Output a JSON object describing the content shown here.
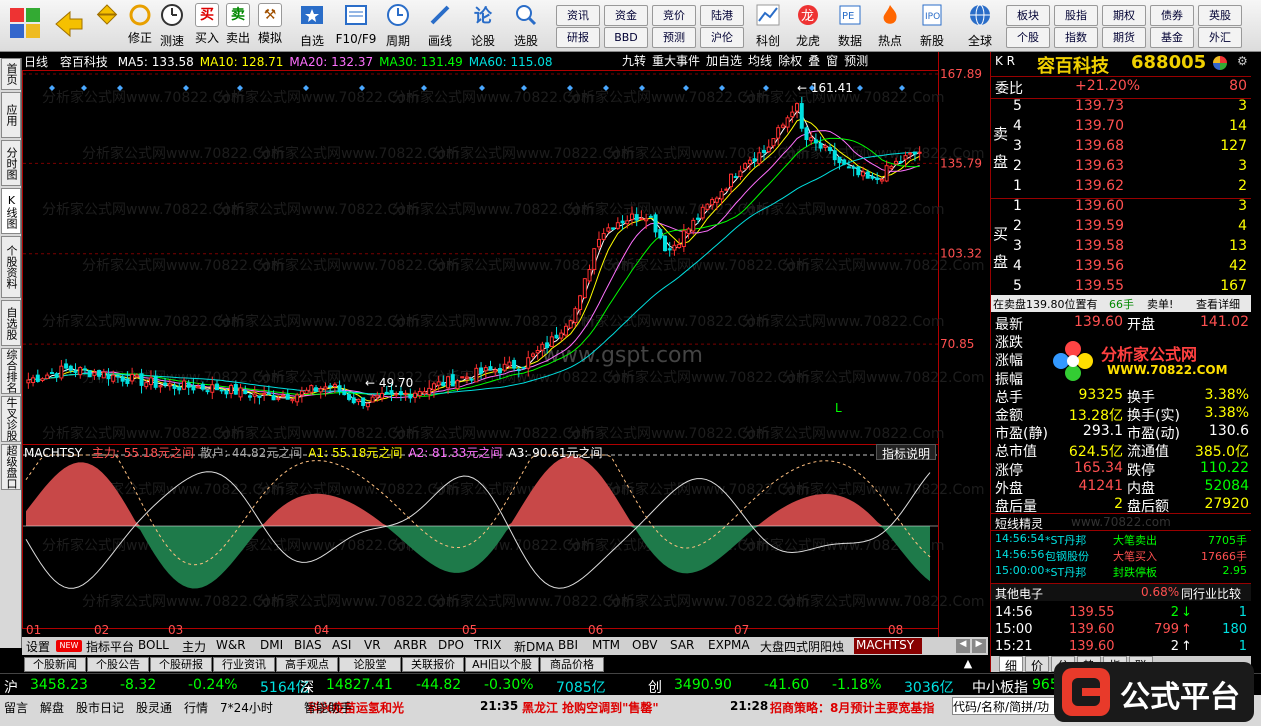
{
  "toolbar": {
    "left_buttons": [
      {
        "icon": "买",
        "label": "买入"
      },
      {
        "icon": "卖",
        "label": "卖出"
      },
      {
        "icon": "⚒",
        "label": "模拟"
      }
    ],
    "back_fwd": [
      {
        "label": "修正"
      },
      {
        "label": "测速"
      }
    ],
    "main_buttons": [
      {
        "label": "自选"
      },
      {
        "label": "F10/F9"
      },
      {
        "label": "周期"
      },
      {
        "label": "画线"
      },
      {
        "label": "论股"
      },
      {
        "label": "选股"
      }
    ],
    "small_grid1": [
      "资讯",
      "资金",
      "竞价",
      "陆港",
      "研报",
      "BBD",
      "预测",
      "沪伦"
    ],
    "icon_buttons": [
      {
        "label": "科创"
      },
      {
        "label": "龙虎"
      },
      {
        "label": "数据"
      },
      {
        "label": "热点"
      },
      {
        "label": "新股"
      }
    ],
    "global_label": "全球",
    "small_grid2": [
      "板块",
      "股指",
      "期权",
      "债券",
      "英股",
      "个股",
      "指数",
      "期货",
      "基金",
      "外汇"
    ]
  },
  "side_tabs": [
    "首页",
    "应用",
    "分时图",
    "K线图",
    "个股资料",
    "自选股",
    "综合排名",
    "牛叉诊股",
    "超级盘口"
  ],
  "chart": {
    "period_label": "日线",
    "stock_name": "容百科技",
    "ma_line": [
      {
        "text": "MA5: 133.58",
        "color": "#ffffff"
      },
      {
        "text": "MA10: 128.71",
        "color": "#ffff00"
      },
      {
        "text": "MA20: 132.37",
        "color": "#ff70ff"
      },
      {
        "text": "MA30: 131.49",
        "color": "#00ff00"
      },
      {
        "text": "MA60: 115.08",
        "color": "#00e0e0"
      }
    ],
    "top_tools": [
      "九转",
      "重大事件",
      "加自选",
      "均线",
      "除权",
      "叠",
      "窗",
      "预测"
    ],
    "price_axis": [
      "167.89",
      "135.79",
      "103.32",
      "70.85"
    ],
    "high_label": "161.41",
    "low_label": "49.70",
    "watermark_site": "www.gspt.com",
    "watermark_text": "分析家公式网www.70822.Com",
    "l_marker": "L"
  },
  "indicator": {
    "title": "MACHTSY",
    "fields": [
      {
        "text": "主力: 55.18元之间",
        "color": "#ff5050"
      },
      {
        "text": "散户: 44.82元之间",
        "color": "#aaaaaa"
      },
      {
        "text": "A1: 55.18元之间",
        "color": "#ffff00"
      },
      {
        "text": "A2: 81.33元之间",
        "color": "#ff70ff"
      },
      {
        "text": "A3: 90.61元之间",
        "color": "#ffffff"
      }
    ],
    "explain_btn": "指标说明"
  },
  "x_axis": [
    "01",
    "02",
    "03",
    "04",
    "05",
    "06",
    "07",
    "08"
  ],
  "bottom_tabs": [
    "设置",
    "指标平台",
    "BOLL",
    "主力",
    "W&R",
    "DMI",
    "BIAS",
    "ASI",
    "VR",
    "ARBR",
    "DPO",
    "TRIX",
    "新DMA",
    "BBI",
    "MTM",
    "OBV",
    "SAR",
    "EXPMA",
    "大盘四式阴阳烛",
    "MACHTSY"
  ],
  "new_badge": "NEW",
  "news_tabs": [
    "个股新闻",
    "个股公告",
    "个股研报",
    "行业资讯",
    "高手观点",
    "论股堂",
    "关联报价",
    "AH旧以个股",
    "商品价格"
  ],
  "quote": {
    "header_left": "K R",
    "stock_title": "容百科技",
    "stock_code": "688005",
    "weibi_label": "委比",
    "weibi_value": "+21.20%",
    "weibi_diff": "80",
    "sell_side": "卖盘",
    "buy_side": "买盘",
    "sells": [
      {
        "lvl": "5",
        "price": "139.73",
        "vol": "3"
      },
      {
        "lvl": "4",
        "price": "139.70",
        "vol": "14"
      },
      {
        "lvl": "3",
        "price": "139.68",
        "vol": "127"
      },
      {
        "lvl": "2",
        "price": "139.63",
        "vol": "3"
      },
      {
        "lvl": "1",
        "price": "139.62",
        "vol": "2"
      }
    ],
    "buys": [
      {
        "lvl": "1",
        "price": "139.60",
        "vol": "3"
      },
      {
        "lvl": "2",
        "price": "139.59",
        "vol": "4"
      },
      {
        "lvl": "3",
        "price": "139.58",
        "vol": "13"
      },
      {
        "lvl": "4",
        "price": "139.56",
        "vol": "42"
      },
      {
        "lvl": "5",
        "price": "139.55",
        "vol": "167"
      }
    ],
    "order_line": "在卖盘139.80位置有",
    "order_vol": "66手",
    "order_tag": "卖单!",
    "detail_link": "查看详细",
    "stats": [
      {
        "l1": "最新",
        "v1": "139.60",
        "l2": "开盘",
        "v2": "141.02",
        "c1": "#ff5050",
        "c2": "#ff5050"
      },
      {
        "l1": "涨跌",
        "v1": "",
        "l2": "",
        "v2": "",
        "c1": "#ff5050",
        "c2": "#ff5050"
      },
      {
        "l1": "涨幅",
        "v1": "",
        "l2": "",
        "v2": "",
        "c1": "#ff5050",
        "c2": "#ff5050"
      },
      {
        "l1": "振幅",
        "v1": "",
        "l2": "",
        "v2": "",
        "c1": "#ffffff",
        "c2": "#ffffff"
      },
      {
        "l1": "总手",
        "v1": "93325",
        "l2": "换手",
        "v2": "3.38%",
        "c1": "#ffff00",
        "c2": "#ffff00"
      },
      {
        "l1": "金额",
        "v1": "13.28亿",
        "l2": "换手(实)",
        "v2": "3.38%",
        "c1": "#ffff00",
        "c2": "#ffff00"
      },
      {
        "l1": "市盈(静)",
        "v1": "293.1",
        "l2": "市盈(动)",
        "v2": "130.6",
        "c1": "#ffffff",
        "c2": "#ffffff"
      },
      {
        "l1": "总市值",
        "v1": "624.5亿",
        "l2": "流通值",
        "v2": "385.0亿",
        "c1": "#ffff00",
        "c2": "#ffff00"
      },
      {
        "l1": "涨停",
        "v1": "165.34",
        "l2": "跌停",
        "v2": "110.22",
        "c1": "#ff5050",
        "c2": "#00ff00"
      },
      {
        "l1": "外盘",
        "v1": "41241",
        "l2": "内盘",
        "v2": "52084",
        "c1": "#ff5050",
        "c2": "#00ff00"
      },
      {
        "l1": "盘后量",
        "v1": "2",
        "l2": "盘后额",
        "v2": "27920",
        "c1": "#ffff00",
        "c2": "#ffff00"
      }
    ],
    "logo_text": "分析家公式网",
    "logo_site": "WWW.70822.COM",
    "short_title": "短线精灵",
    "short_site": "www.70822.com",
    "short_items": [
      {
        "time": "14:56:54",
        "name": "*ST丹邦",
        "event": "大笔卖出",
        "val": "7705手",
        "col": "#00ff00"
      },
      {
        "time": "14:56:56",
        "name": "包钢股份",
        "event": "大笔买入",
        "val": "17666手",
        "col": "#ff5050"
      },
      {
        "time": "15:00:00",
        "name": "*ST丹邦",
        "event": "封跌停板",
        "val": "2.95",
        "col": "#00ff00"
      }
    ],
    "sector_label": "其他电子",
    "sector_pct": "0.68%",
    "sector_btn": "同行业比较",
    "ticks": [
      {
        "time": "14:56",
        "price": "139.55",
        "vol": "2",
        "arrow": "↓",
        "count": "1",
        "vcol": "#00ff00"
      },
      {
        "time": "15:00",
        "price": "139.60",
        "vol": "799",
        "arrow": "↑",
        "count": "180",
        "vcol": "#ff5050"
      },
      {
        "time": "15:21",
        "price": "139.60",
        "vol": "2",
        "arrow": "↑",
        "count": "1",
        "vcol": "#ffffff"
      }
    ],
    "bottom_tabs": [
      "细",
      "价",
      "分",
      "势",
      "指",
      "联"
    ]
  },
  "index_bar": [
    {
      "name": "沪",
      "value": "3458.23",
      "chg": "-8.32",
      "pct": "-0.24%",
      "amt": "5164亿"
    },
    {
      "name": "深",
      "value": "14827.41",
      "chg": "-44.82",
      "pct": "-0.30%",
      "amt": "7085亿"
    },
    {
      "name": "创",
      "value": "3490.90",
      "chg": "-41.60",
      "pct": "-1.18%",
      "amt": "3036亿"
    }
  ],
  "index_extra": "中小板指",
  "index_extra_val": "965",
  "status": {
    "items": [
      "留言",
      "解盘",
      "股市日记",
      "股灵通",
      "行情",
      "7*24小时",
      "智能助手"
    ],
    "news1": "科兴疫苗运氢和光",
    "news2_time": "21:35",
    "news2": "黑龙江 抢购空调到\"售罄\"",
    "news3_time": "21:28",
    "news3": "招商策略：8月预计主要宽基指",
    "code_hint": "代码/名称/简拼/功",
    "brand": "公式平台"
  }
}
